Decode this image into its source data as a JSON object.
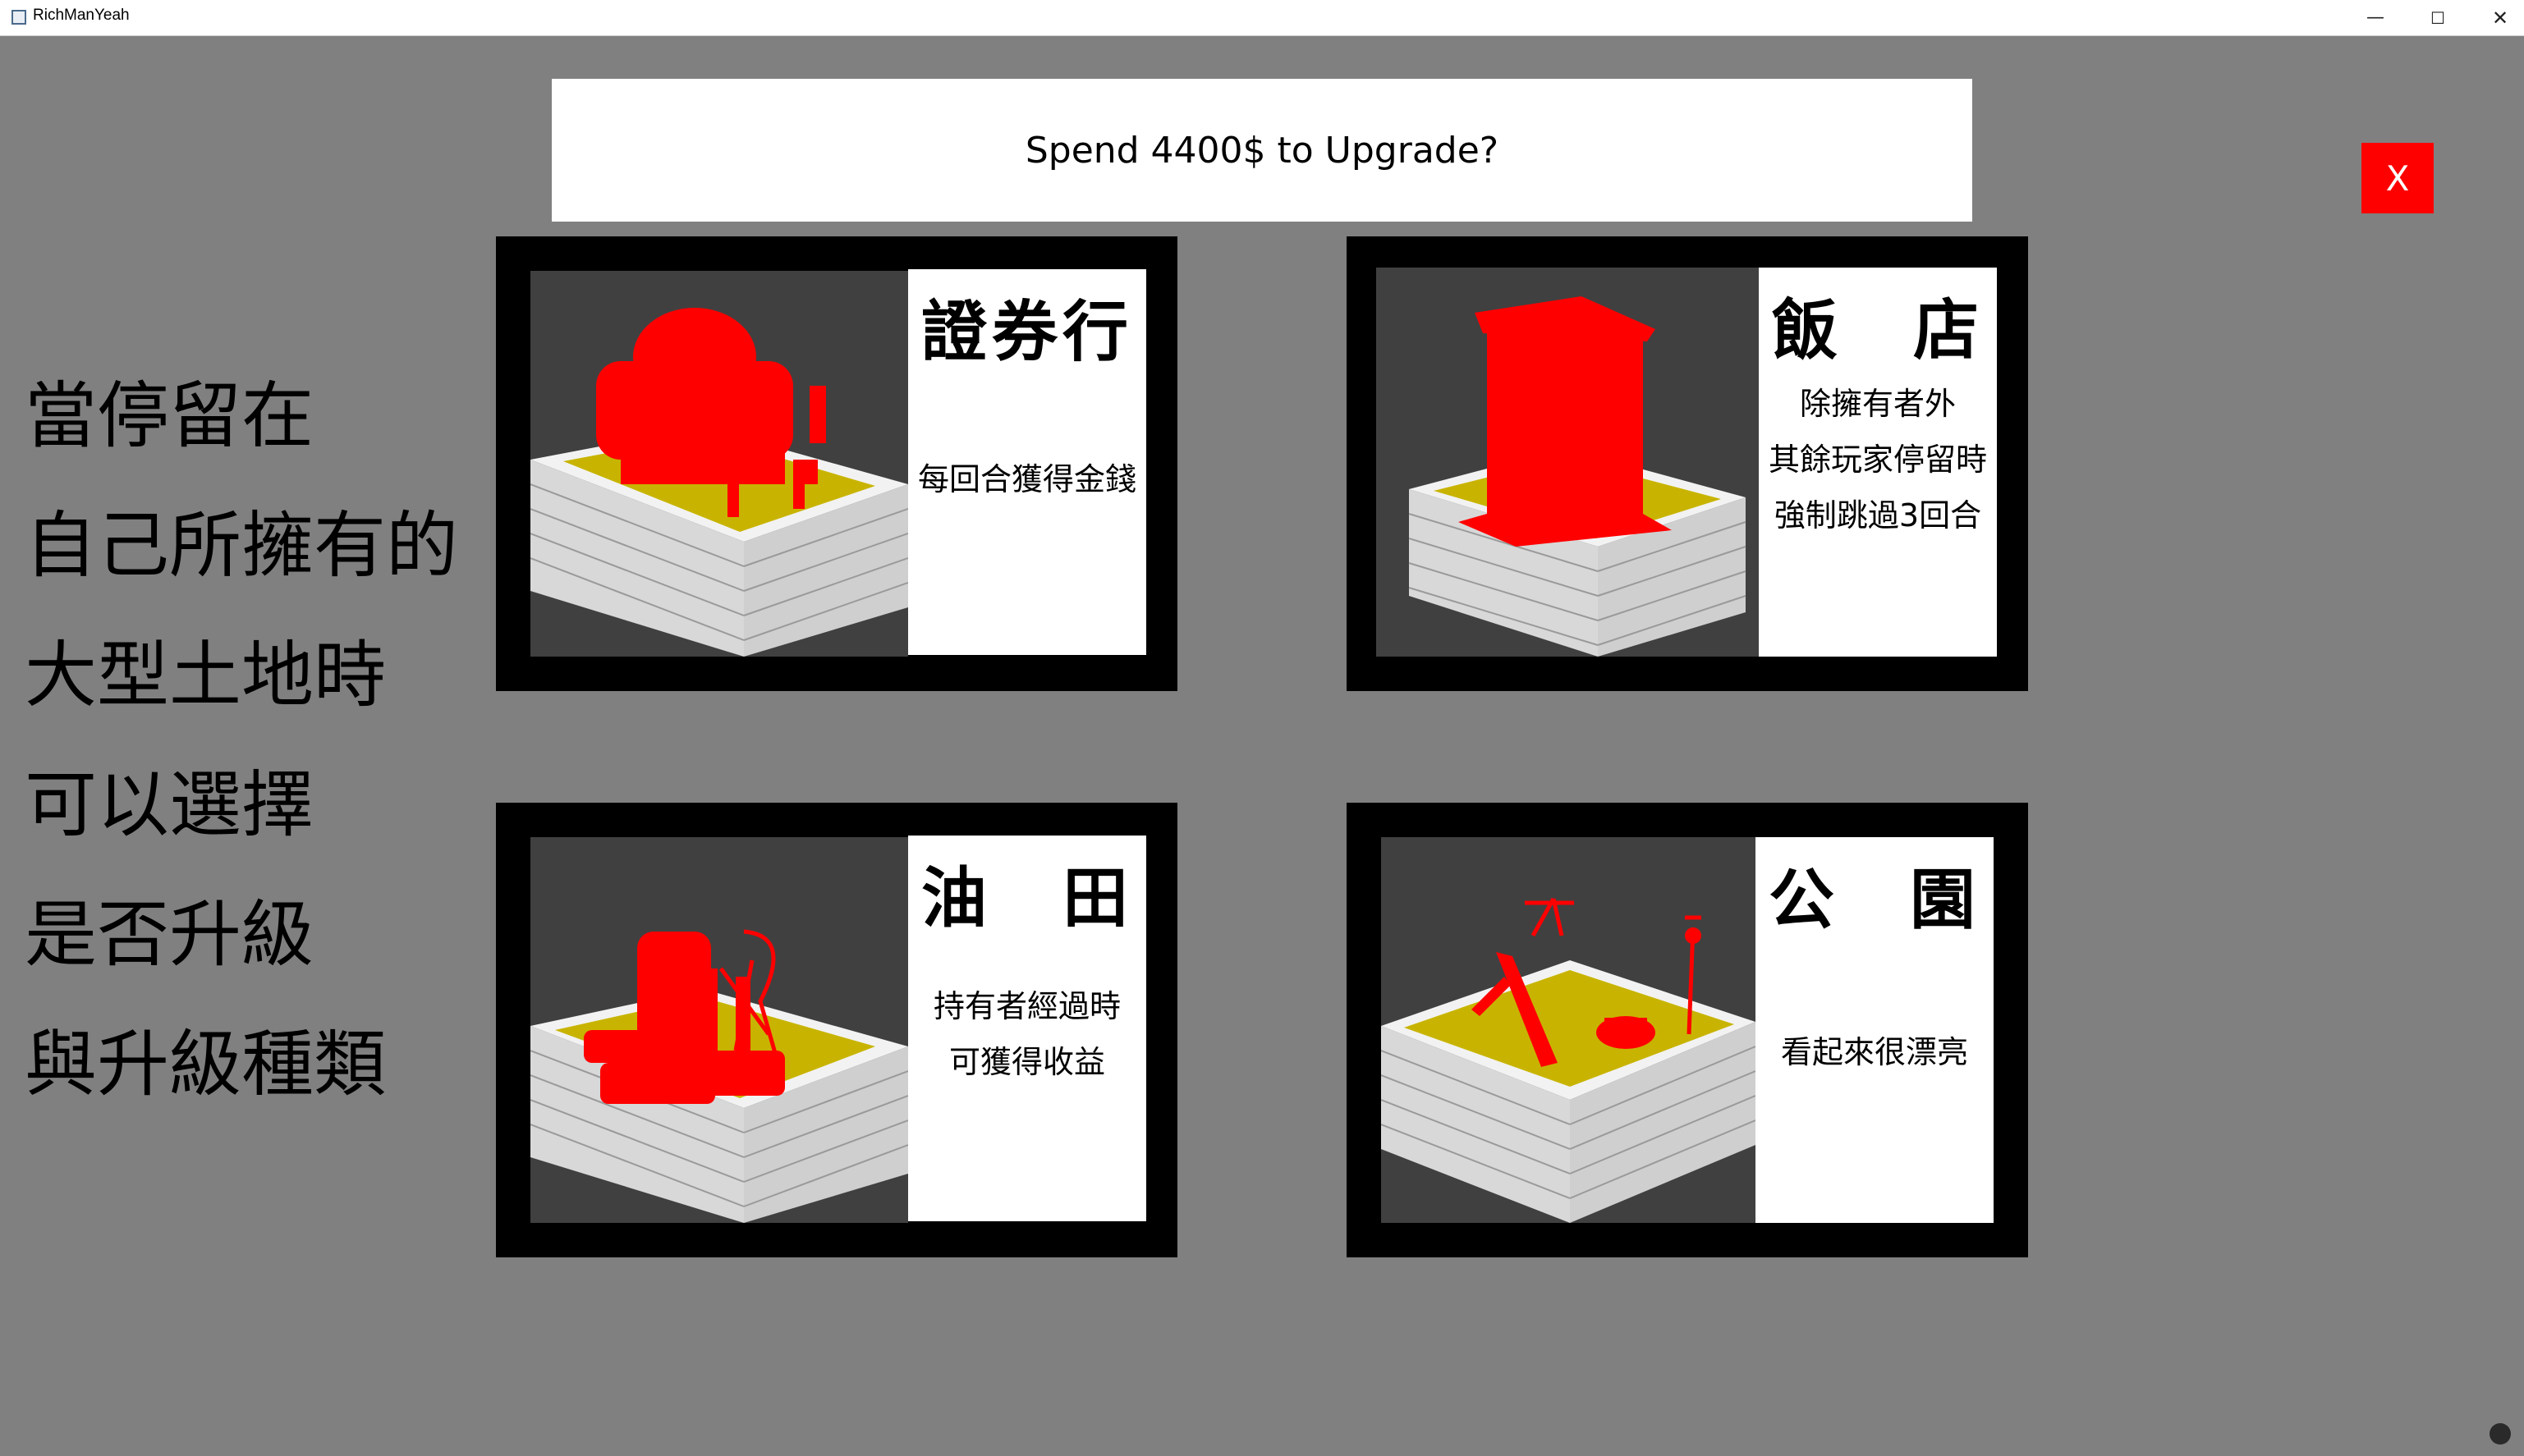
{
  "window": {
    "title": "RichManYeah",
    "minimize_glyph": "—",
    "maximize_glyph": "☐",
    "close_glyph": "✕"
  },
  "prompt": {
    "text": "Spend 4400$ to Upgrade?"
  },
  "close_button": {
    "label": "X",
    "color": "#ff0000"
  },
  "description": {
    "lines": [
      "當停留在",
      "自己所擁有的",
      "大型土地時",
      "可以選擇",
      "是否升級",
      "與升級種類"
    ]
  },
  "options": [
    {
      "title": "證券行",
      "lines": [
        "每回合獲得金錢"
      ],
      "model_icon": "bank-building-model"
    },
    {
      "title": "飯　店",
      "lines": [
        "除擁有者外",
        "其餘玩家停留時",
        "強制跳過3回合"
      ],
      "model_icon": "hotel-tower-model"
    },
    {
      "title": "油　田",
      "lines": [
        "持有者經過時",
        "可獲得收益"
      ],
      "model_icon": "oil-pump-model"
    },
    {
      "title": "公　園",
      "lines": [
        "看起來很漂亮"
      ],
      "model_icon": "playground-model"
    }
  ],
  "colors": {
    "background": "#808080",
    "model": "#ff0000",
    "ground": "#c8b400",
    "scene_bg": "#404040"
  }
}
